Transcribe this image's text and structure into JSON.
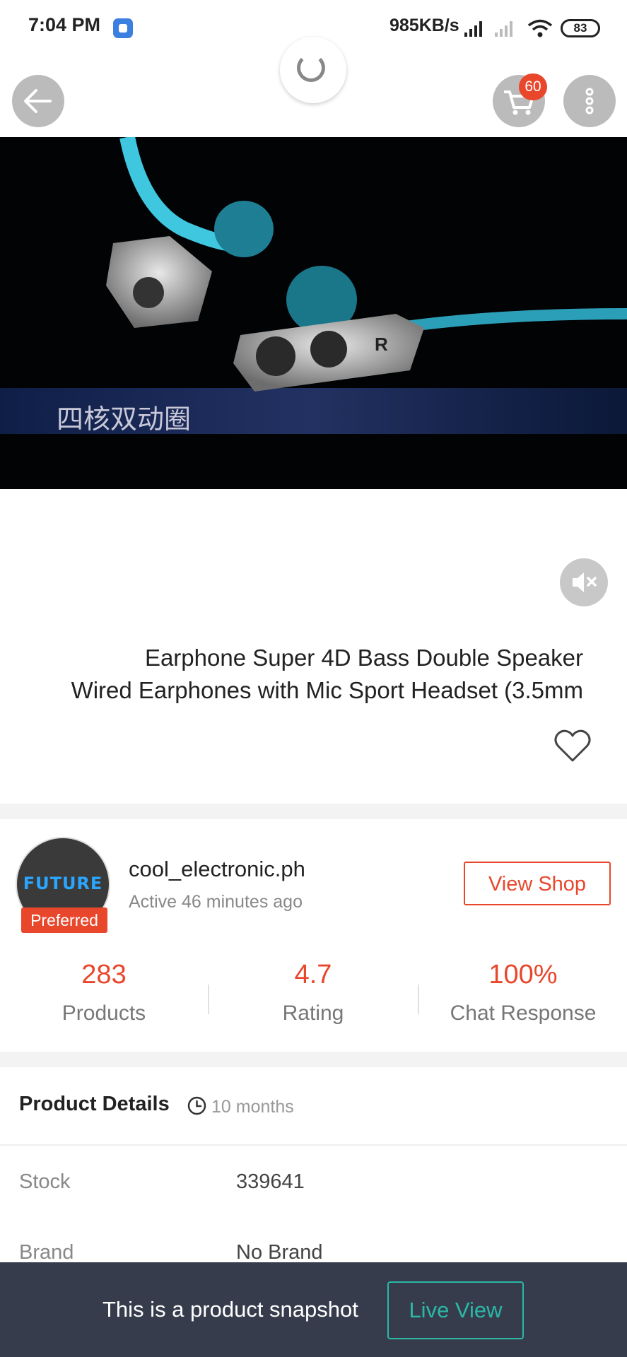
{
  "status_bar": {
    "time": "7:04 PM",
    "network_speed": "985KB/s",
    "battery": "83",
    "icons": [
      "app-notification-icon",
      "cellular-signal-icon",
      "cellular-signal-no-service-icon",
      "wifi-icon",
      "battery-icon"
    ]
  },
  "nav": {
    "back_icon": "arrow-left-icon",
    "cart_icon": "shopping-cart-icon",
    "cart_badge": "60",
    "more_icon": "more-vertical-icon",
    "loading_icon": "loading-spinner-icon"
  },
  "media": {
    "overlay_caption": "四核双动圈",
    "mute_icon": "volume-mute-icon"
  },
  "product": {
    "title_line1": "Earphone Super 4D Bass Double Speaker",
    "title_line2": "Wired Earphones with Mic Sport Headset (3.5mm",
    "wishlist_icon": "heart-outline-icon"
  },
  "shop": {
    "avatar_text": "FUTURE",
    "badge": "Preferred",
    "name": "cool_electronic.ph",
    "active_status": "Active 46 minutes ago",
    "view_shop_label": "View Shop",
    "stats": [
      {
        "value": "283",
        "label": "Products"
      },
      {
        "value": "4.7",
        "label": "Rating"
      },
      {
        "value": "100%",
        "label": "Chat Response"
      }
    ]
  },
  "details": {
    "title": "Product Details",
    "clock_icon": "clock-icon",
    "time_ago": "10 months",
    "specs": [
      {
        "label": "Stock",
        "value": "339641"
      },
      {
        "label": "Brand",
        "value": "No Brand"
      }
    ]
  },
  "snapshot_banner": {
    "text": "This is a product snapshot",
    "live_view_label": "Live View"
  },
  "colors": {
    "accent": "#e8472c",
    "banner_bg": "#363c4c",
    "live_view": "#2bb8a6"
  }
}
